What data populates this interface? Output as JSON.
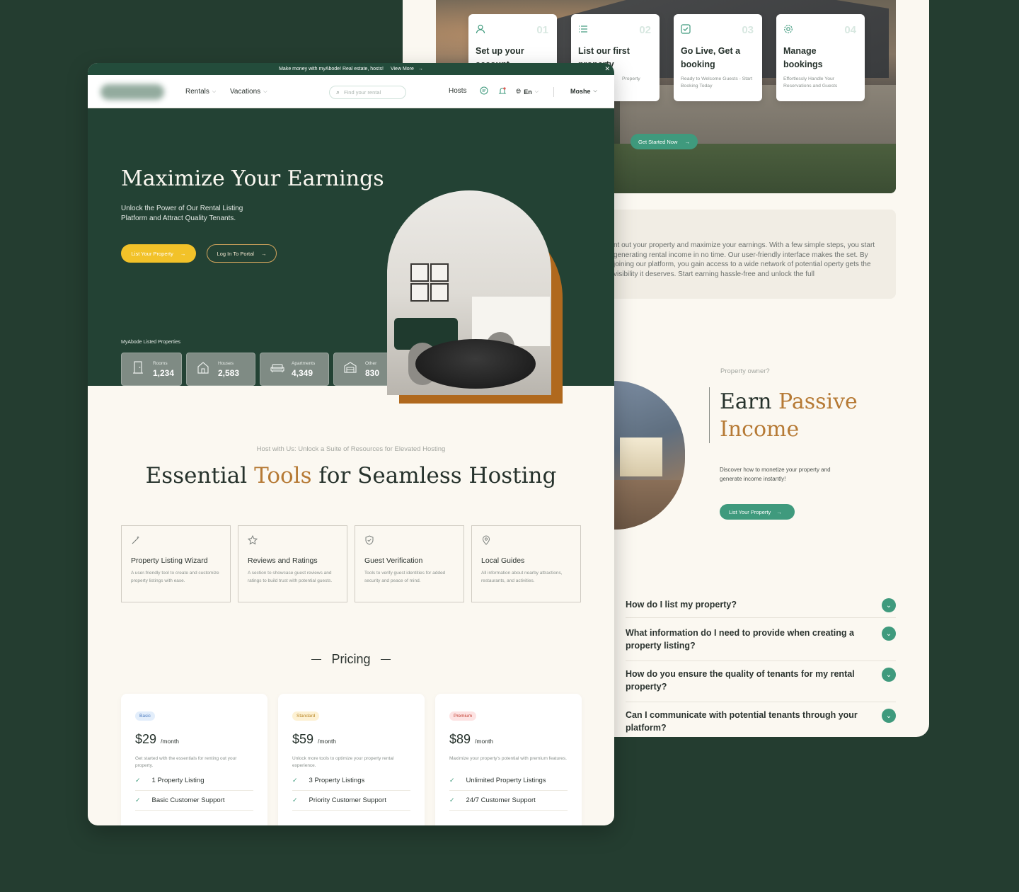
{
  "steps": [
    {
      "num": "01",
      "title": "Set up your account",
      "desc": "",
      "icon": "user-icon"
    },
    {
      "num": "02",
      "title": "List our first property",
      "desc": "Property",
      "icon": "list-icon"
    },
    {
      "num": "03",
      "title": "Go Live, Get a booking",
      "desc": "Ready to Welcome Guests - Start Booking Today",
      "icon": "check-square-icon"
    },
    {
      "num": "04",
      "title": "Manage bookings",
      "desc": "Effortlessly Handle Your Reservations and Guests",
      "icon": "gear-icon"
    }
  ],
  "get_started": "Get Started Now",
  "about_text": "nt out your property and maximize your earnings. With a few simple steps, you start generating rental income in no time. Our user-friendly interface makes the set. By joining our platform, you gain access to a wide network of potential operty gets the visibility it deserves. Start earning hassle-free and unlock the full",
  "owner": {
    "kicker": "Property owner?",
    "title_a": "Earn ",
    "title_b": "Passive",
    "title_c": "Income",
    "desc": "Discover how to monetize your property and generate income instantly!",
    "button": "List Your Property"
  },
  "faq": [
    "How do I list my property?",
    "What information do I need to provide when creating a property listing?",
    "How do you ensure the quality of tenants for my rental property?",
    "Can I communicate with potential tenants through your platform?"
  ],
  "promo": {
    "text": "Make money with myAbode! Real estate, hosts!",
    "link": "View More"
  },
  "nav": {
    "rentals": "Rentals",
    "vacations": "Vacations",
    "search_placeholder": "Find your rental",
    "hosts": "Hosts",
    "language": "En",
    "user": "Moshe"
  },
  "hero": {
    "title": "Maximize Your Earnings",
    "subtitle": "Unlock the Power of Our Rental Listing Platform and Attract Quality Tenants.",
    "btn_primary": "List Your Property",
    "btn_secondary": "Log In To Portal",
    "listed_label": "MyAbode Listed Properties",
    "stats": [
      {
        "label": "Rooms",
        "value": "1,234",
        "icon": "door-icon"
      },
      {
        "label": "Houses",
        "value": "2,583",
        "icon": "house-icon"
      },
      {
        "label": "Apartments",
        "value": "4,349",
        "icon": "sofa-icon"
      },
      {
        "label": "Other",
        "value": "830",
        "icon": "garage-icon"
      }
    ]
  },
  "tools": {
    "kicker": "Host with Us: Unlock a Suite of Resources for Elevated Hosting",
    "title_a": "Essential ",
    "title_b": "Tools",
    "title_c": " for Seamless Hosting",
    "cards": [
      {
        "title": "Property Listing Wizard",
        "desc": "A user-friendly tool to create and customize property listings with ease.",
        "icon": "magic-wand-icon"
      },
      {
        "title": "Reviews and Ratings",
        "desc": "A section to showcase guest reviews and ratings to build trust with potential guests.",
        "icon": "star-icon"
      },
      {
        "title": "Guest Verification",
        "desc": "Tools to verify guest identities for added security and peace of mind.",
        "icon": "shield-check-icon"
      },
      {
        "title": "Local Guides",
        "desc": "All information about nearby attractions, restaurants, and activities.",
        "icon": "map-pin-icon"
      }
    ]
  },
  "pricing": {
    "title": "Pricing",
    "plans": [
      {
        "tier": "Basic",
        "price": "$29",
        "per": "/month",
        "desc": "Get started with the essentials for renting out your property.",
        "features": [
          "1 Property Listing",
          "Basic Customer Support"
        ]
      },
      {
        "tier": "Standard",
        "price": "$59",
        "per": "/month",
        "desc": "Unlock more tools to optimize your property rental experience.",
        "features": [
          "3 Property Listings",
          "Priority Customer Support"
        ]
      },
      {
        "tier": "Premium",
        "price": "$89",
        "per": "/month",
        "desc": "Maximize your property's potential with premium features.",
        "features": [
          "Unlimited Property Listings",
          "24/7 Customer Support"
        ]
      }
    ]
  },
  "colors": {
    "brand_green": "#234234",
    "accent_teal": "#3f9a7d",
    "accent_gold": "#b67a35",
    "accent_yellow": "#f2c229"
  }
}
